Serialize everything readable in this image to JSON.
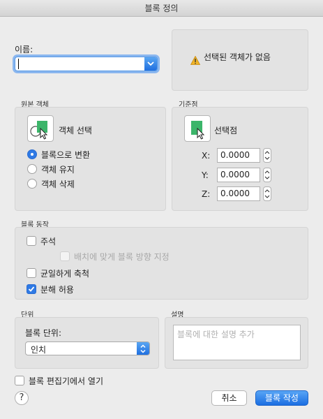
{
  "window": {
    "title": "블록 정의"
  },
  "name": {
    "label": "이름:",
    "value": ""
  },
  "status": {
    "message": "선택된 객체가 없음",
    "icon": "warning-icon"
  },
  "source_objects": {
    "section_title": "원본 객체",
    "select_label": "객체 선택",
    "options": [
      "블록으로 변환",
      "객체 유지",
      "객체 삭제"
    ],
    "selected": 0
  },
  "base_point": {
    "section_title": "기준점",
    "pick_label": "선택점",
    "x_label": "X:",
    "x_value": "0.0000",
    "y_label": "Y:",
    "y_value": "0.0000",
    "z_label": "Z:",
    "z_value": "0.0000"
  },
  "behavior": {
    "section_title": "블록 동작",
    "annotative": {
      "label": "주석",
      "checked": false
    },
    "match_orientation": {
      "label": "배치에 맞게 블록 방향 지정",
      "checked": false,
      "disabled": true
    },
    "scale_uniformly": {
      "label": "균일하게 축척",
      "checked": false
    },
    "allow_exploding": {
      "label": "분해 허용",
      "checked": true
    }
  },
  "units": {
    "section_title": "단위",
    "block_unit_label": "블록 단위:",
    "block_unit_value": "인치"
  },
  "description": {
    "section_title": "설명",
    "placeholder": "블록에 대한 설명 추가"
  },
  "open_in_editor": {
    "label": "블록 편집기에서 열기",
    "checked": false
  },
  "buttons": {
    "help": "?",
    "cancel": "취소",
    "create": "블록 작성"
  },
  "colors": {
    "accent": "#2f7ae5",
    "icon_green": "#3cb56a"
  }
}
